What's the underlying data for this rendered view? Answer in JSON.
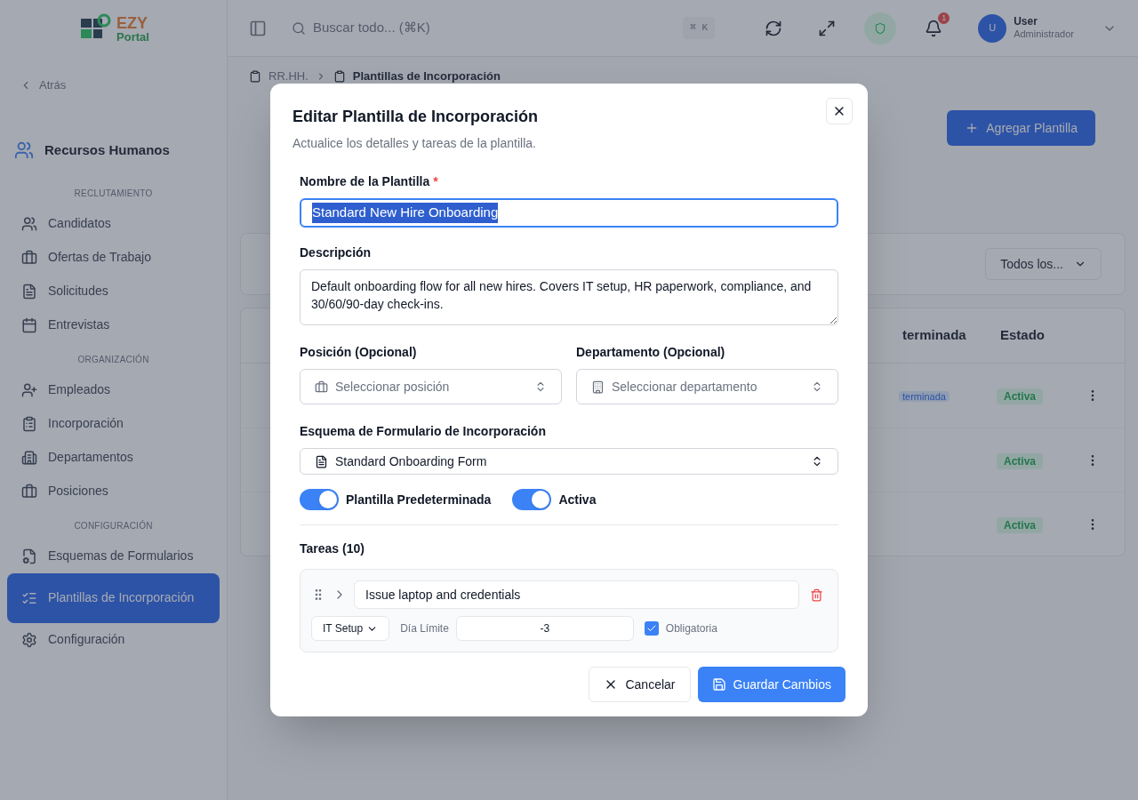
{
  "header": {
    "logo": {
      "line1": "EZY",
      "line2": "Portal"
    },
    "search": {
      "placeholder": "Buscar todo... (⌘K)"
    },
    "shortcut": "⌘ K",
    "notifications": {
      "count": "1"
    },
    "user": {
      "avatar": "U",
      "name": "User",
      "role": "Administrador"
    }
  },
  "sidebar": {
    "back": "Atrás",
    "module": "Recursos Humanos",
    "sections": [
      {
        "title": "RECLUTAMIENTO",
        "items": [
          {
            "label": "Candidatos",
            "selected": false
          },
          {
            "label": "Ofertas de Trabajo",
            "selected": false
          },
          {
            "label": "Solicitudes",
            "selected": false
          },
          {
            "label": "Entrevistas",
            "selected": false
          }
        ]
      },
      {
        "title": "ORGANIZACIÓN",
        "items": [
          {
            "label": "Empleados",
            "selected": false
          },
          {
            "label": "Incorporación",
            "selected": false
          },
          {
            "label": "Departamentos",
            "selected": false
          },
          {
            "label": "Posiciones",
            "selected": false
          }
        ]
      },
      {
        "title": "CONFIGURACIÓN",
        "items": [
          {
            "label": "Esquemas de Formularios",
            "selected": false
          },
          {
            "label": "Plantillas de Incorporación",
            "selected": true
          },
          {
            "label": "Configuración",
            "selected": false
          }
        ]
      }
    ]
  },
  "breadcrumb": [
    "RR.HH.",
    "Plantillas de Incorporación"
  ],
  "page": {
    "add_button": "Agregar Plantilla",
    "filter": "Todos los...",
    "table": {
      "columns": [
        "terminada",
        "Estado"
      ],
      "rows": [
        {
          "default": "terminada",
          "status": "Activa"
        },
        {
          "status": "Activa"
        },
        {
          "status": "Activa"
        }
      ]
    }
  },
  "dialog": {
    "title": "Editar Plantilla de Incorporación",
    "subtitle": "Actualice los detalles y tareas de la plantilla.",
    "name": {
      "label": "Nombre de la Plantilla",
      "required": true,
      "required_mark": "*",
      "value": "Standard New Hire Onboarding",
      "selected": true
    },
    "description": {
      "label": "Descripción",
      "value": "Default onboarding flow for all new hires. Covers IT setup, HR paperwork, compliance, and 30/60/90-day check-ins."
    },
    "position": {
      "label": "Posición (Opcional)",
      "placeholder": "Seleccionar posición"
    },
    "department": {
      "label": "Departamento (Opcional)",
      "placeholder": "Seleccionar departamento"
    },
    "form_schema": {
      "label": "Esquema de Formulario de Incorporación",
      "value": "Standard Onboarding Form"
    },
    "toggles": [
      {
        "label": "Plantilla Predeterminada",
        "on": true
      },
      {
        "label": "Activa",
        "on": true
      }
    ],
    "tasks_title": "Tareas (10)",
    "tasks": [
      {
        "title": "Issue laptop and credentials",
        "expanded": false,
        "category": "IT Setup",
        "due_label": "Día Límite",
        "due": "-3",
        "required_label": "Obligatoria",
        "required": true
      }
    ],
    "buttons": {
      "cancel": "Cancelar",
      "save": "Guardar Cambios"
    }
  }
}
